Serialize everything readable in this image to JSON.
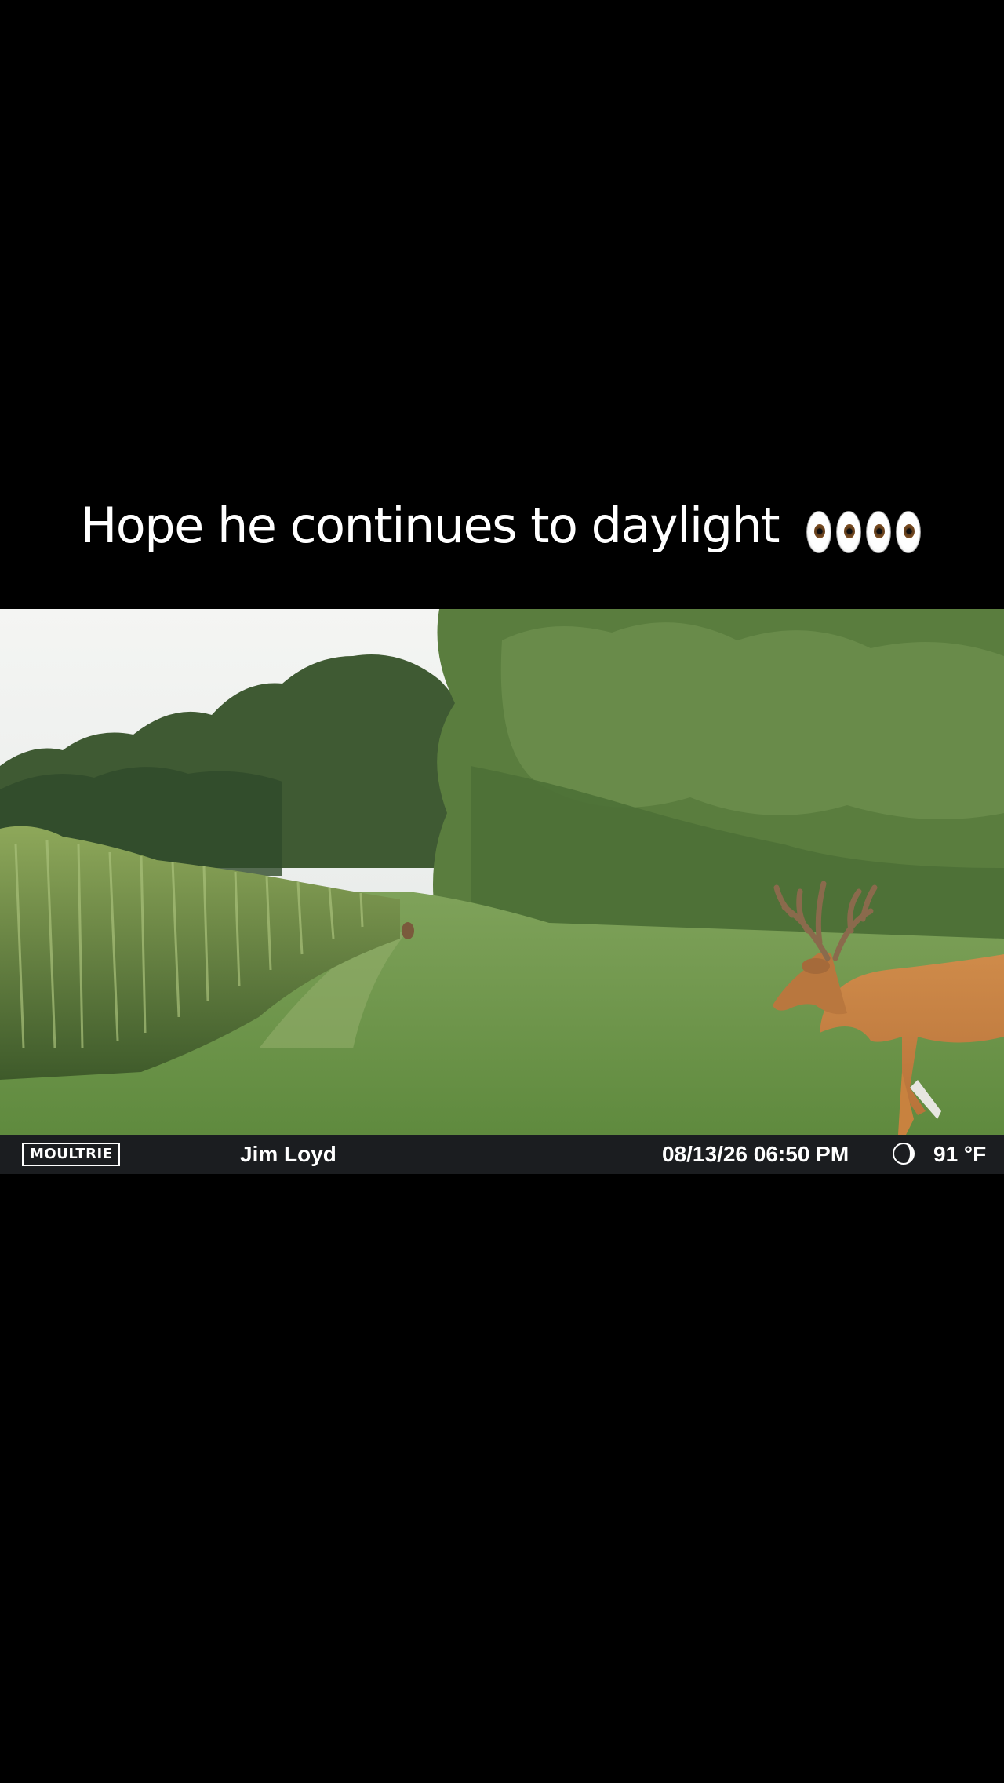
{
  "caption": {
    "text": "Hope he continues to daylight",
    "emoji_icons": [
      "eyes-emoji-icon",
      "eyes-emoji-icon"
    ]
  },
  "trail_camera": {
    "brand": "MOULTRIE",
    "camera_name": "Jim Loyd",
    "timestamp": "08/13/26 06:50 PM",
    "moon_phase_icon": "moon-phase-icon",
    "temperature": "91 °F"
  },
  "colors": {
    "background": "#000000",
    "caption_text": "#ffffff",
    "info_bar": "#1b1d20"
  }
}
